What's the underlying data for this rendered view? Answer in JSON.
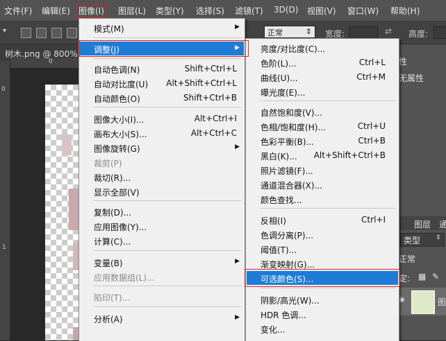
{
  "menubar": {
    "file": "文件(F)",
    "edit": "编辑(E)",
    "image": "图像(I)",
    "layer": "图层(L)",
    "type": "类型(Y)",
    "select": "选择(S)",
    "filter": "滤镜(T)",
    "3d": "3D(D)",
    "view": "视图(V)",
    "window": "窗口(W)",
    "help": "帮助(H)"
  },
  "options": {
    "mode_value": "正常",
    "opacity_label": "宽度:",
    "height_label": "高度:"
  },
  "document": {
    "tab_title": "树木.png @ 800%",
    "ruler_zero": "0",
    "ruler_left_zero": "0",
    "ruler_left_one": "1"
  },
  "panel": {
    "tab1": "性",
    "tab1b": "无属性",
    "tab_layers": "图层",
    "tab_channels": "通",
    "kind_label": "类型",
    "blend_mode": "正常",
    "lock_label": "定:",
    "layer_name": "图"
  },
  "image_menu": {
    "mode": "模式(M)",
    "adjust": "调整(J)",
    "auto_tone": "自动色调(N)",
    "auto_tone_sc": "Shift+Ctrl+L",
    "auto_contrast": "自动对比度(U)",
    "auto_contrast_sc": "Alt+Shift+Ctrl+L",
    "auto_color": "自动颜色(O)",
    "auto_color_sc": "Shift+Ctrl+B",
    "image_size": "图像大小(I)...",
    "image_size_sc": "Alt+Ctrl+I",
    "canvas_size": "画布大小(S)...",
    "canvas_size_sc": "Alt+Ctrl+C",
    "rotate": "图像旋转(G)",
    "crop": "裁剪(P)",
    "trim": "裁切(R)...",
    "reveal_all": "显示全部(V)",
    "duplicate": "复制(D)...",
    "apply_image": "应用图像(Y)...",
    "calculations": "计算(C)...",
    "variables": "变量(B)",
    "apply_dataset": "应用数据组(L)...",
    "trap": "陷印(T)...",
    "analysis": "分析(A)"
  },
  "adjust_menu": {
    "brightness": "亮度/对比度(C)...",
    "levels": "色阶(L)...",
    "levels_sc": "Ctrl+L",
    "curves": "曲线(U)...",
    "curves_sc": "Ctrl+M",
    "exposure": "曝光度(E)...",
    "vibrance": "自然饱和度(V)...",
    "hue_sat": "色相/饱和度(H)...",
    "hue_sat_sc": "Ctrl+U",
    "color_balance": "色彩平衡(B)...",
    "color_balance_sc": "Ctrl+B",
    "bw": "黑白(K)...",
    "bw_sc": "Alt+Shift+Ctrl+B",
    "photo_filter": "照片滤镜(F)...",
    "channel_mixer": "通道混合器(X)...",
    "color_lookup": "颜色查找...",
    "invert": "反相(I)",
    "invert_sc": "Ctrl+I",
    "posterize": "色调分离(P)...",
    "threshold": "阈值(T)...",
    "gradient_map": "渐变映射(G)...",
    "selective_color": "可选颜色(S)...",
    "shadows": "阴影/高光(W)...",
    "hdr": "HDR 色调...",
    "variations": "变化..."
  }
}
